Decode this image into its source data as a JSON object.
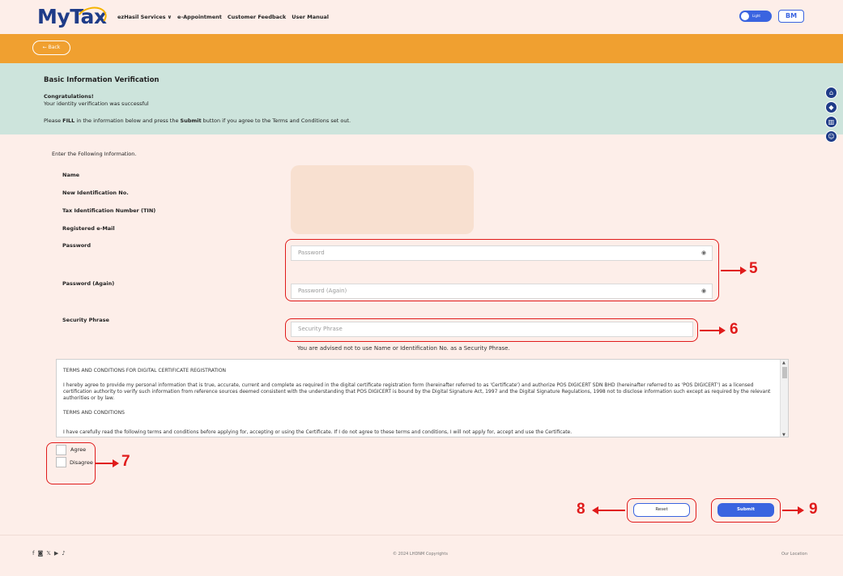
{
  "header": {
    "logo_prefix": "My",
    "logo_suffix": "Tax",
    "nav": [
      "ezHasil Services ∨",
      "e-Appointment",
      "Customer Feedback",
      "User Manual"
    ],
    "toggle_label": "Light",
    "lang_button": "BM"
  },
  "back_button": "← Back",
  "intro": {
    "title": "Basic Information Verification",
    "congrats": "Congratulations!",
    "success": "Your identity verification was successful",
    "instruction_pre": "Please ",
    "instruction_fill": "FILL",
    "instruction_mid": " in the information below and press the ",
    "instruction_submit": "Submit",
    "instruction_post": " button if you agree to the Terms and Conditions set out."
  },
  "side_icons": [
    "home-icon",
    "bell-icon",
    "book-icon",
    "support-icon"
  ],
  "form": {
    "heading": "Enter the Following Information.",
    "labels": {
      "name": "Name",
      "nric": "New Identification No.",
      "tin": "Tax Identification Number (TIN)",
      "email": "Registered e-Mail",
      "password": "Password",
      "password_again": "Password (Again)",
      "security_phrase": "Security Phrase"
    },
    "placeholders": {
      "password": "Password",
      "password_again": "Password (Again)",
      "security_phrase": "Security Phrase"
    },
    "security_advice": "You are advised not to use Name or Identification No. as a Security Phrase."
  },
  "terms": {
    "heading": "TERMS AND CONDITIONS FOR DIGITAL CERTIFICATE REGISTRATION",
    "para1": "I hereby agree to provide my personal information that is true, accurate, current and complete as required in the digital certificate registration form (hereinafter referred to as 'Certificate') and authorize POS DIGICERT SDN BHD (hereinafter referred to as 'POS DIGICERT') as a licensed certification authority to verify such information from reference sources deemed consistent with the understanding that POS DIGICERT is bound by the Digital Signature Act, 1997 and the Digital Signature Regulations, 1998 not to disclose information such except as required by the relevant authorities or by law.",
    "heading2": "TERMS AND CONDITIONS",
    "para2": "I have carefully read the following terms and conditions before applying for, accepting or using the Certificate. If I do not agree to these terms and conditions, I will not apply for, accept and use the Certificate."
  },
  "agree": {
    "agree": "Agree",
    "disagree": "Disagree"
  },
  "buttons": {
    "reset": "Reset",
    "submit": "Submit"
  },
  "callouts": {
    "c5": "5",
    "c6": "6",
    "c7": "7",
    "c8": "8",
    "c9": "9"
  },
  "footer": {
    "social": [
      "f",
      "◙",
      "𝕏",
      "▶",
      "♪"
    ],
    "copyright": "© 2024 LHDNM Copyrights",
    "location": "Our Location"
  }
}
